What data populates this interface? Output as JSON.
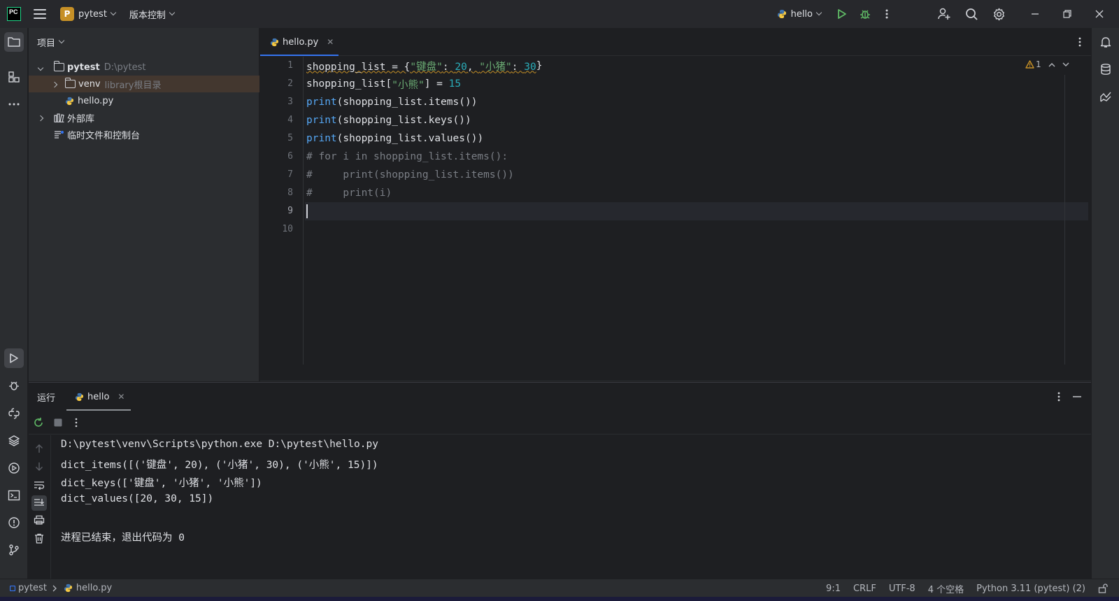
{
  "titlebar": {
    "app_logo": "PC",
    "project_badge": "P",
    "project_name": "pytest",
    "vcs_menu": "版本控制",
    "run_config": "hello"
  },
  "project_panel": {
    "title": "项目",
    "tree": [
      {
        "label": "pytest",
        "hint": "D:\\pytest"
      },
      {
        "label": "venv",
        "hint": "library根目录"
      },
      {
        "label": "hello.py"
      },
      {
        "label": "外部库"
      },
      {
        "label": "临时文件和控制台"
      }
    ]
  },
  "editor": {
    "tab_label": "hello.py",
    "warning_count": "1",
    "line_numbers": [
      "1",
      "2",
      "3",
      "4",
      "5",
      "6",
      "7",
      "8",
      "9",
      "10"
    ]
  },
  "run_panel": {
    "title": "运行",
    "tab_label": "hello",
    "console": [
      "D:\\pytest\\venv\\Scripts\\python.exe D:\\pytest\\hello.py",
      "dict_items([('键盘', 20), ('小猪', 30), ('小熊', 15)])",
      "dict_keys(['键盘', '小猪', '小熊'])",
      "dict_values([20, 30, 15])",
      "",
      "进程已结束，退出代码为 0"
    ]
  },
  "statusbar": {
    "breadcrumb_project": "pytest",
    "breadcrumb_file": "hello.py",
    "position": "9:1",
    "line_ending": "CRLF",
    "encoding": "UTF-8",
    "indent": "4 个空格",
    "interpreter": "Python 3.11 (pytest) (2)"
  },
  "colors": {
    "accent": "#3574f0",
    "string": "#6aab73",
    "number": "#2aacb8",
    "function": "#56a8f5",
    "comment": "#7a7e85",
    "run_green": "#5fb865"
  }
}
